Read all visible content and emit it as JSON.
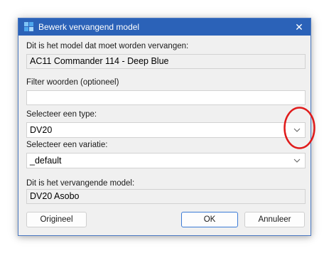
{
  "window": {
    "title": "Bewerk vervangend model",
    "close_glyph": "✕"
  },
  "fields": {
    "original_label": "Dit is het model dat moet worden vervangen:",
    "original_value": "AC11 Commander 114 - Deep Blue",
    "filter_label": "Filter woorden (optioneel)",
    "filter_value": "",
    "filter_placeholder": "",
    "type_label": "Selecteer een type:",
    "type_value": "DV20",
    "variation_label": "Selecteer een variatie:",
    "variation_value": "_default",
    "replacement_label": "Dit is het vervangende model:",
    "replacement_value": "DV20 Asobo"
  },
  "buttons": {
    "original": "Origineel",
    "ok": "OK",
    "cancel": "Annuleer"
  },
  "colors": {
    "titlebar": "#2b62b8",
    "dialog_bg": "#f0f0f0",
    "annotation": "#e01b1b",
    "primary_border": "#3b7bd6"
  },
  "icons": {
    "app": "app-icon",
    "close": "close-icon",
    "dropdown": "chevron-down-icon"
  }
}
